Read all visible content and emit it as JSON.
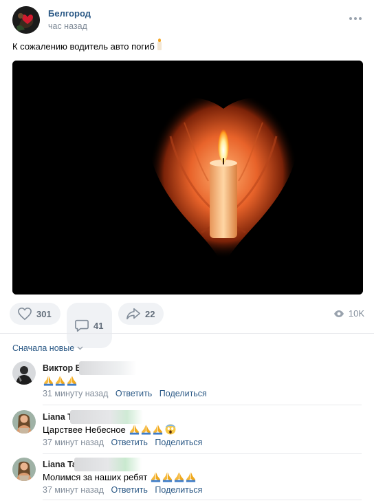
{
  "post": {
    "group_name": "Белгород",
    "time": "час назад",
    "text": "К сожалению водитель авто погиб",
    "photo_subject": "hands-holding-candle"
  },
  "actions": {
    "likes": "301",
    "comments": "41",
    "shares": "22",
    "views": "10K"
  },
  "comments_sort": "Сначала новые",
  "comments": [
    {
      "author": "Виктор В",
      "text": "",
      "emoji": [
        "pray",
        "pray",
        "pray"
      ],
      "time": "31 минуту назад",
      "reply": "Ответить",
      "share": "Поделиться"
    },
    {
      "author": "Liana T",
      "text": "Царствее Небесное",
      "emoji": [
        "pray",
        "pray",
        "pray",
        "scream"
      ],
      "time": "37 минут назад",
      "reply": "Ответить",
      "share": "Поделиться"
    },
    {
      "author": "Liana Ta",
      "text": "Молимся за наших ребят",
      "emoji": [
        "pray",
        "pray",
        "pray",
        "pray"
      ],
      "time": "37 минут назад",
      "reply": "Ответить",
      "share": "Поделиться"
    }
  ],
  "colors": {
    "link": "#2a5885",
    "secondary": "#818c99",
    "action_bg": "#f0f2f5"
  }
}
